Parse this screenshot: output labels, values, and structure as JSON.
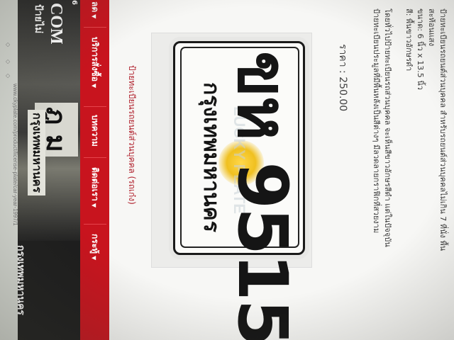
{
  "browser": {
    "url": "www.ckyplate.com/product/license-plate/car-year-1997/1"
  },
  "banner": {
    "plate_line1": "ฎุ ม",
    "plate_line2": "กรุงเทพมหานคร",
    "top_text": "กรุงเทพมหานคร",
    "brand": "COM",
    "brand_sub": "ป้ายไม่",
    "left_digit": "6"
  },
  "nav": {
    "items": [
      {
        "label": "บริการสั่งซื้อ"
      },
      {
        "label": "บทความ"
      },
      {
        "label": "ติดต่อเรา"
      },
      {
        "label": "กระทู้"
      }
    ],
    "partial": "ลด"
  },
  "product": {
    "headline": "ป้ายทะเบียนรถยนต์ส่วนบุคคล (รถเก๋ง)",
    "plate_top": "ขห 9515",
    "plate_bottom": "กรุงเทพมหานคร",
    "watermark": "LUCKY PLATE",
    "price": "ราคา : 250.00"
  },
  "description": [
    "ป้ายทะเบียนรถยนต์ส่วนบุคคล สำหรับรถยนต์ส่วนบุคคลไม่เกิน 7 ที่นั่ง พื้น",
    "สะท้อนแสง",
    "ขนาด: 6 นิ้ว x 13.5 นิ้ว",
    "สี: พื้นขาวอักษรดำ",
    "โดยทั่วไปป้ายทะเบียนรถส่วนบุคคล จะเห็นสีขาวอักษรสีดำ แต่ในปัจจุบัน",
    "ป้ายทะเบียนประมูลที่มีพื้นหลังเป็นสีต่างๆ มีลวดลายกราฟิกที่สวยงาม"
  ],
  "colors": {
    "nav": "#c8141e",
    "headline": "#b0202c"
  }
}
